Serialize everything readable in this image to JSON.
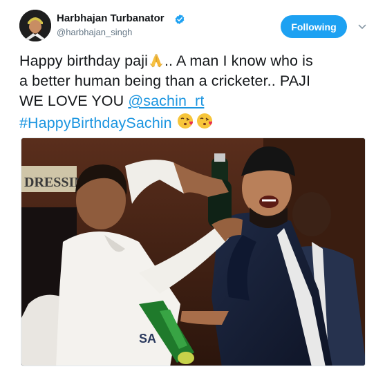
{
  "author": {
    "name": "Harbhajan Turbanator",
    "handle": "@harbhajan_singh",
    "verified": true
  },
  "follow_button": {
    "label": "Following",
    "color": "#1da1f2"
  },
  "menu_icon": "chevron-down-icon",
  "tweet": {
    "line1_text": "Happy birthday paji",
    "line1_emoji": "folded-hands",
    "line1_rest": ".. A man I know who is",
    "line2": "a better human  being than a cricketer.. PAJI",
    "line3_text": "WE LOVE YOU ",
    "mention": "@sachin_rt",
    "hashtag": "#HappyBirthdaySachin",
    "trailing_emojis": [
      "face-blowing-a-kiss",
      "face-blowing-a-kiss"
    ]
  },
  "photo": {
    "sign_text": "DRESSING",
    "shirt_text": "SA"
  },
  "colors": {
    "link": "#1b95e0",
    "text": "#14171a",
    "secondary": "#657786"
  }
}
